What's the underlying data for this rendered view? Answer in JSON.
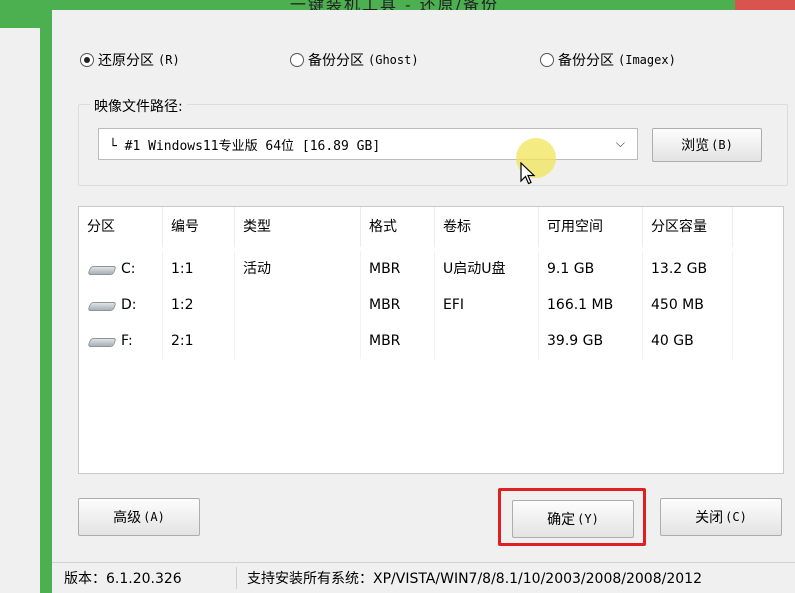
{
  "window": {
    "title": "一键装机工具 - 还原/备份",
    "title_color": "#4caf50"
  },
  "mode": {
    "options": [
      {
        "label": "还原分区",
        "shortcut": "(R)",
        "selected": true
      },
      {
        "label": "备份分区",
        "shortcut": "(Ghost)",
        "selected": false
      },
      {
        "label": "备份分区",
        "shortcut": "(Imagex)",
        "selected": false
      }
    ]
  },
  "image_path": {
    "group_label": "映像文件路径:",
    "selected_value": "└ #1 Windows11专业版 64位 [16.89 GB]",
    "browse_label": "浏览",
    "browse_shortcut": "(B)"
  },
  "partitions": {
    "columns": [
      "分区",
      "编号",
      "类型",
      "格式",
      "卷标",
      "可用空间",
      "分区容量"
    ],
    "rows": [
      {
        "drive": "C:",
        "number": "1:1",
        "type": "活动",
        "format": "MBR",
        "label": "U启动U盘",
        "free": "9.1 GB",
        "capacity": "13.2 GB"
      },
      {
        "drive": "D:",
        "number": "1:2",
        "type": "",
        "format": "MBR",
        "label": "EFI",
        "free": "166.1 MB",
        "capacity": "450 MB"
      },
      {
        "drive": "F:",
        "number": "2:1",
        "type": "",
        "format": "MBR",
        "label": "",
        "free": "39.9 GB",
        "capacity": "40 GB"
      }
    ]
  },
  "buttons": {
    "advanced_label": "高级",
    "advanced_shortcut": "(A)",
    "ok_label": "确定",
    "ok_shortcut": "(Y)",
    "close_label": "关闭",
    "close_shortcut": "(C)",
    "highlight_color": "#e02020"
  },
  "status": {
    "version": "版本：6.1.20.326",
    "support": "支持安装所有系统：XP/VISTA/WIN7/8/8.1/10/2003/2008/2008/2012"
  },
  "icons": [
    "radio-icon",
    "chevron-down-icon",
    "drive-icon",
    "mouse-cursor-icon"
  ]
}
